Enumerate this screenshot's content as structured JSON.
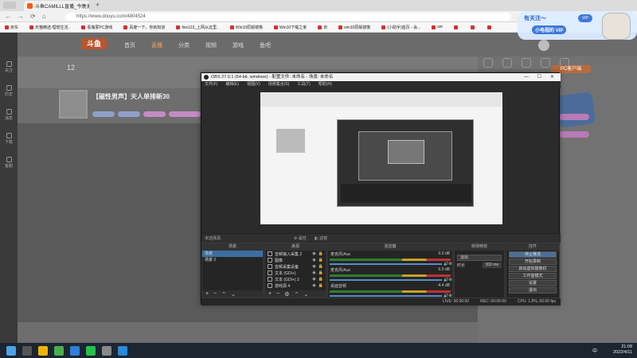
{
  "browser": {
    "tab_title": "斗鱼CAMILLL直播_今晚无间面?…",
    "new_tab": "+",
    "url": "https://www.douyu.com/4804524",
    "bookmarks": [
      "京东",
      "天猫精选-理想生活..",
      "看鬼冢PC游戏",
      "百度一下，你就知道",
      "fws123_上网从这里..",
      "Win10原版镜像",
      "Win10下载之家",
      "京",
      "win10原版镜像",
      "(小助手)首页 - 会...",
      "ser",
      "",
      "",
      ""
    ]
  },
  "widget": {
    "line1": "有关注～",
    "line2": "小电视的 VIP",
    "mark": "VIP"
  },
  "douyu": {
    "logo": "斗鱼",
    "nav": [
      "首页",
      "直播",
      "分类",
      "视频",
      "游戏",
      "鱼吧"
    ],
    "room_title": "【磁性男声】天人单排新30",
    "stat": "12",
    "left_nav": [
      "关注",
      "历史",
      "消息",
      "下载",
      "客服"
    ],
    "right_badge": "PC客户端"
  },
  "obs": {
    "title": "OBS 27.0.1 (64-bit, windows) - 配置文件: 未命名 - 场景: 未命名",
    "menu": [
      "文件(F)",
      "编辑(E)",
      "视图(V)",
      "场景集合(S)",
      "工具(T)",
      "帮助(H)"
    ],
    "no_scene": "未选择源",
    "prop": "属性",
    "filter": "滤镜",
    "scene_header": "场景",
    "scenes": [
      "场景",
      "场景 2"
    ],
    "source_header": "来源",
    "sources": [
      "音频输入采集 2",
      "图像",
      "音频采集设备",
      "文本 (GDI+)",
      "文本 (GDI+) 3",
      "游戏源 4"
    ],
    "mixer_header": "混音器",
    "mixer": [
      {
        "name": "麦克风/Aux",
        "db": "0.0 dB"
      },
      {
        "name": "麦克风/Aux",
        "db": "0.0 dB"
      },
      {
        "name": "桌面音频",
        "db": "-4.4 dB"
      }
    ],
    "transition_header": "转场特效",
    "transition_type": "淡出",
    "duration_label": "时长",
    "duration_value": "300 ms",
    "controls_header": "控件",
    "controls": [
      "停止推流",
      "开始录制",
      "启动虚拟摄像机",
      "工作室模式",
      "设置",
      "退出"
    ],
    "status": {
      "live": "LIVE: 00:00:00",
      "rec": "REC: 00:00:00",
      "cpu": "CPU: 1.8%, 60.00 fps"
    }
  },
  "taskbar": {
    "time": "21:08",
    "date": "2022/4/11",
    "lang": "中"
  }
}
